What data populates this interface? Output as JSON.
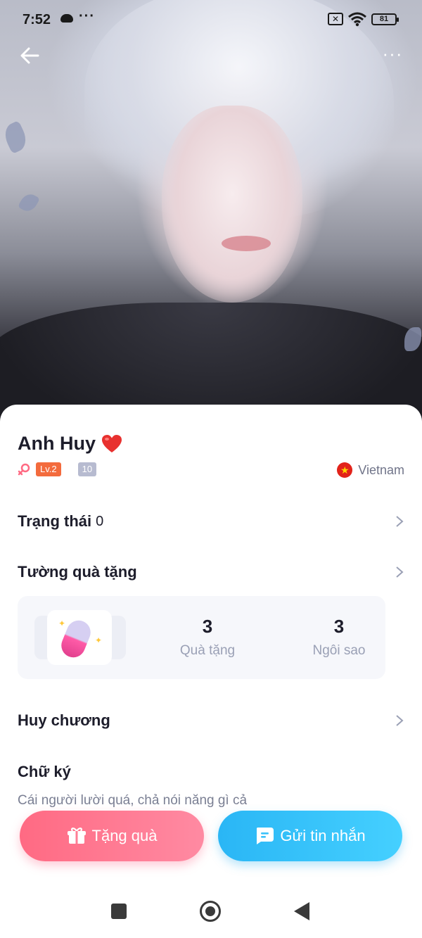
{
  "status_bar": {
    "time": "7:52",
    "dots": "···",
    "battery": "81"
  },
  "profile": {
    "name": "Anh Huy",
    "level": "Lv.2",
    "badge_number": "10",
    "country": "Vietnam"
  },
  "sections": {
    "status": {
      "title": "Trạng thái",
      "count": "0"
    },
    "gift_wall": {
      "title": "Tường quà tặng"
    },
    "medals": {
      "title": "Huy chương"
    },
    "signature": {
      "title": "Chữ ký",
      "text": "Cái người lười quá, chả nói năng gì cả"
    }
  },
  "gift_stats": [
    {
      "value": "3",
      "label": "Quà tặng"
    },
    {
      "value": "3",
      "label": "Ngôi sao"
    }
  ],
  "actions": {
    "gift_button": "Tặng quà",
    "message_button": "Gửi tin nhắn"
  },
  "colors": {
    "accent_pink": "#ff6a83",
    "accent_blue": "#2ab6f5",
    "level_badge": "#f36b3d",
    "country_flag": "#e2231a"
  },
  "icons": {
    "back": "arrow-left-icon",
    "more": "more-dots-icon",
    "heart": "heart-icon",
    "gender": "female-icon",
    "flag": "vietnam-flag-icon",
    "gift": "gift-icon",
    "message": "chat-bubble-icon"
  }
}
